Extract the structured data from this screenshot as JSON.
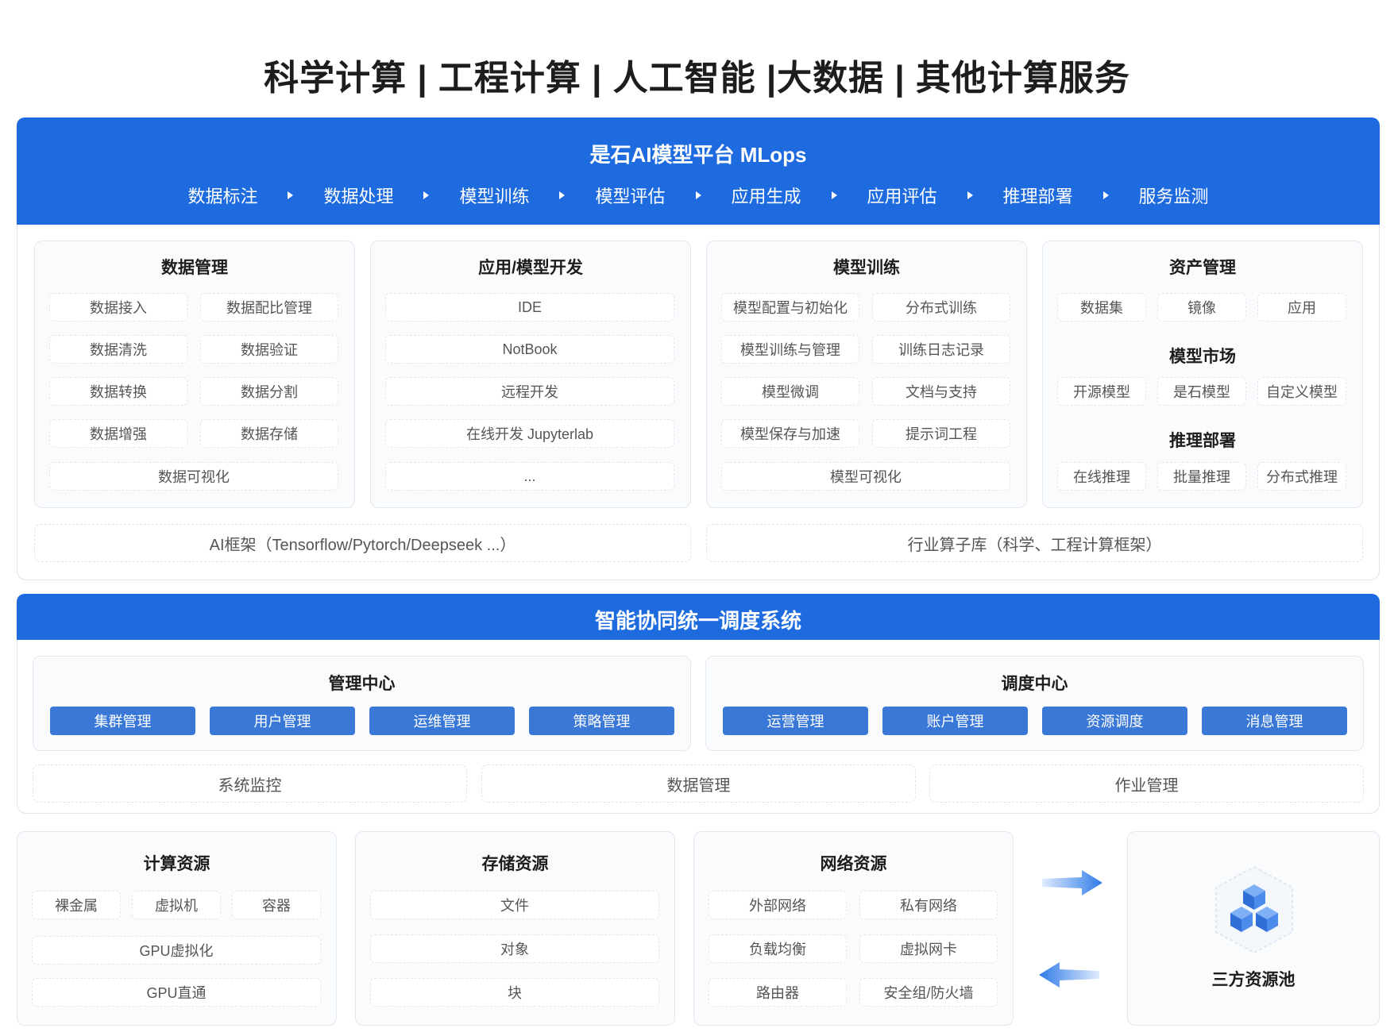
{
  "title": "科学计算 | 工程计算 | 人工智能 |大数据 | 其他计算服务",
  "mlops": {
    "title": "是石AI模型平台 MLops",
    "pipeline": [
      "数据标注",
      "数据处理",
      "模型训练",
      "模型评估",
      "应用生成",
      "应用评估",
      "推理部署",
      "服务监测"
    ]
  },
  "modules": {
    "data_mgmt": {
      "title": "数据管理",
      "items": [
        "数据接入",
        "数据配比管理",
        "数据清洗",
        "数据验证",
        "数据转换",
        "数据分割",
        "数据增强",
        "数据存储"
      ],
      "bottom": "数据可视化"
    },
    "dev": {
      "title": "应用/模型开发",
      "items": [
        "IDE",
        "NotBook",
        "远程开发",
        "在线开发 Jupyterlab",
        "..."
      ]
    },
    "training": {
      "title": "模型训练",
      "items": [
        "模型配置与初始化",
        "分布式训练",
        "模型训练与管理",
        "训练日志记录",
        "模型微调",
        "文档与支持",
        "模型保存与加速",
        "提示词工程"
      ],
      "bottom": "模型可视化"
    },
    "assets": {
      "title": "资产管理",
      "items": [
        "数据集",
        "镜像",
        "应用"
      ],
      "market_title": "模型市场",
      "market_items": [
        "开源模型",
        "是石模型",
        "自定义模型"
      ],
      "deploy_title": "推理部署",
      "deploy_items": [
        "在线推理",
        "批量推理",
        "分布式推理"
      ]
    }
  },
  "frameworks": {
    "ai": "AI框架（Tensorflow/Pytorch/Deepseek ...）",
    "industry": "行业算子库（科学、工程计算框架）"
  },
  "scheduler": {
    "title": "智能协同统一调度系统",
    "mgmt_center": {
      "title": "管理中心",
      "buttons": [
        "集群管理",
        "用户管理",
        "运维管理",
        "策略管理"
      ]
    },
    "dispatch_center": {
      "title": "调度中心",
      "buttons": [
        "运营管理",
        "账户管理",
        "资源调度",
        "消息管理"
      ]
    },
    "bottom": [
      "系统监控",
      "数据管理",
      "作业管理"
    ]
  },
  "resources": {
    "compute": {
      "title": "计算资源",
      "row1": [
        "裸金属",
        "虚拟机",
        "容器"
      ],
      "rows": [
        "GPU虚拟化",
        "GPU直通"
      ]
    },
    "storage": {
      "title": "存储资源",
      "items": [
        "文件",
        "对象",
        "块"
      ]
    },
    "network": {
      "title": "网络资源",
      "items": [
        "外部网络",
        "私有网络",
        "负载均衡",
        "虚拟网卡",
        "路由器",
        "安全组/防火墙"
      ]
    },
    "pool": {
      "title": "三方资源池",
      "icon": "cubes-icon"
    }
  },
  "colors": {
    "primary_blue": "#1e6be0",
    "button_blue": "#3a78d8",
    "arrow_blue": "#2f7be8"
  }
}
